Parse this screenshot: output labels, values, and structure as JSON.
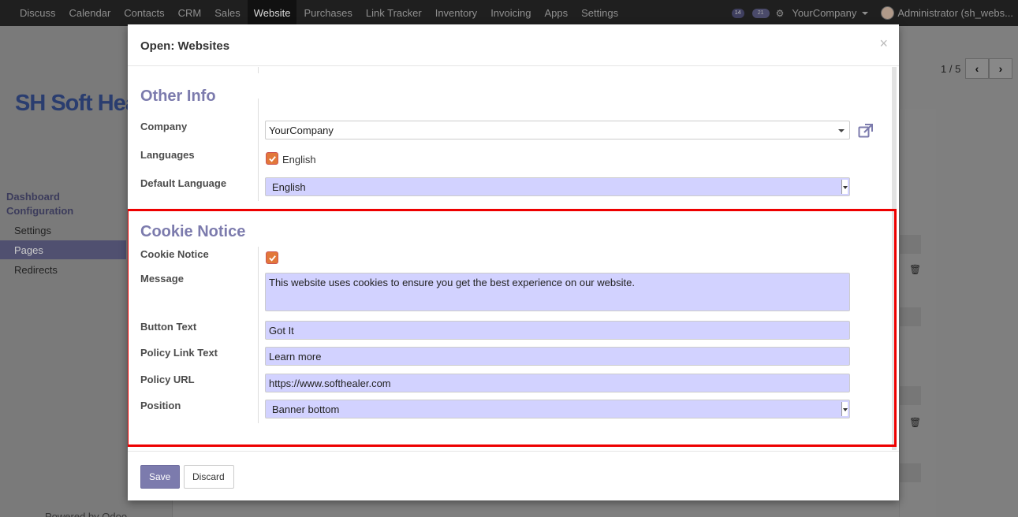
{
  "navbar": {
    "menus": [
      "Discuss",
      "Calendar",
      "Contacts",
      "CRM",
      "Sales",
      "Website",
      "Purchases",
      "Link Tracker",
      "Inventory",
      "Invoicing",
      "Apps",
      "Settings"
    ],
    "active_menu": "Website",
    "activity_count": "14",
    "message_count": "21",
    "company": "YourCompany",
    "user": "Administrator (sh_webs..."
  },
  "background": {
    "logo_text": "SH Soft Hea",
    "menu_heading_1": "Dashboard",
    "menu_heading_2": "Configuration",
    "menu_items": [
      "Settings",
      "Pages",
      "Redirects"
    ],
    "powered_by": "Powered by Odoo",
    "pager": "1 / 5"
  },
  "modal": {
    "title": "Open: Websites",
    "close_label": "×",
    "other_info": {
      "section_title": "Other Info",
      "company_label": "Company",
      "company_value": "YourCompany",
      "languages_label": "Languages",
      "languages_value": "English",
      "default_language_label": "Default Language",
      "default_language_value": "English"
    },
    "cookie_notice": {
      "section_title": "Cookie Notice",
      "cookie_notice_label": "Cookie Notice",
      "message_label": "Message",
      "message_value": "This website uses cookies to ensure you get the best experience on our website.",
      "button_text_label": "Button Text",
      "button_text_value": "Got It",
      "policy_link_text_label": "Policy Link Text",
      "policy_link_text_value": "Learn more",
      "policy_url_label": "Policy URL",
      "policy_url_value": "https://www.softhealer.com",
      "position_label": "Position",
      "position_value": "Banner bottom"
    },
    "footer": {
      "save_label": "Save",
      "discard_label": "Discard"
    }
  },
  "colors": {
    "accent": "#7c7bad",
    "required_field": "#d2d2ff",
    "checkbox": "#e2773a",
    "highlight_box": "#ee0000"
  }
}
